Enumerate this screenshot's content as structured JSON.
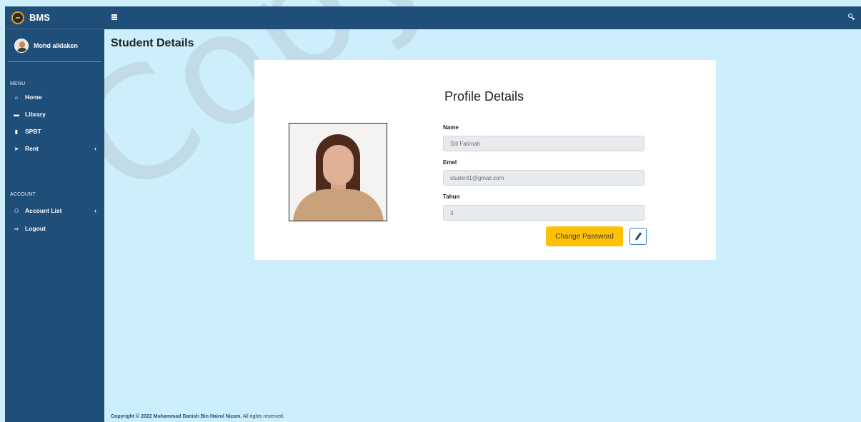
{
  "brand": {
    "name": "BMS"
  },
  "user": {
    "name": "Mohd alklaken"
  },
  "sidebar": {
    "menu_label": "MENU",
    "menu_items": [
      {
        "label": "Home",
        "icon": "home-icon"
      },
      {
        "label": "Library",
        "icon": "library-icon"
      },
      {
        "label": "SPBT",
        "icon": "book-icon"
      },
      {
        "label": "Rent",
        "icon": "send-icon",
        "has_chevron": true
      }
    ],
    "account_label": "ACCOUNT",
    "account_items": [
      {
        "label": "Account List",
        "icon": "users-icon",
        "has_chevron": true
      },
      {
        "label": "Logout",
        "icon": "logout-icon"
      }
    ]
  },
  "page": {
    "title": "Student Details"
  },
  "profile": {
    "title": "Profile Details",
    "fields": [
      {
        "label": "Name",
        "value": "Siti Fatimah"
      },
      {
        "label": "Emel",
        "value": "student1@gmail.com"
      },
      {
        "label": "Tahun",
        "value": "3"
      }
    ],
    "change_password_label": "Change Password"
  },
  "footer": {
    "copyright_bold": "Copyright © 2022 Muhammad Danish Bin Hairol Nizam.",
    "copyright_rest": " All rights reserved."
  },
  "watermark": "Copyright UKM",
  "colors": {
    "primary": "#1f4e79",
    "background": "#cdeefb",
    "warning": "#ffc107"
  }
}
